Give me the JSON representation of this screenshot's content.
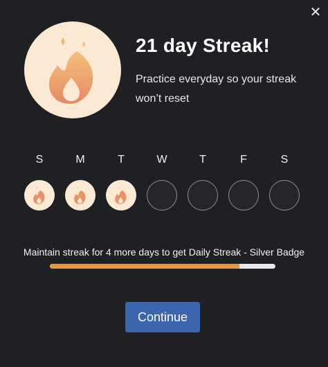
{
  "dialog": {
    "close_glyph": "✕",
    "title": "21 day Streak!",
    "subtitle": "Practice everyday so your streak won’t reset",
    "hero_icon": "flame-icon"
  },
  "week": {
    "days": [
      {
        "letter": "S",
        "completed": true
      },
      {
        "letter": "M",
        "completed": true
      },
      {
        "letter": "T",
        "completed": true
      },
      {
        "letter": "W",
        "completed": false
      },
      {
        "letter": "T",
        "completed": false
      },
      {
        "letter": "F",
        "completed": false
      },
      {
        "letter": "S",
        "completed": false
      }
    ]
  },
  "progress": {
    "label": "Maintain streak for 4 more days to get Daily Streak - Silver Badge",
    "fraction": 0.84
  },
  "actions": {
    "continue_label": "Continue"
  },
  "colors": {
    "background": "#1f2023",
    "badge": "#fce9d3",
    "flame_top": "#f5c07a",
    "flame_bottom": "#e58a63",
    "progress_fill": "#e8953a",
    "progress_track": "#e9e9e9",
    "button": "#3b66ae"
  }
}
